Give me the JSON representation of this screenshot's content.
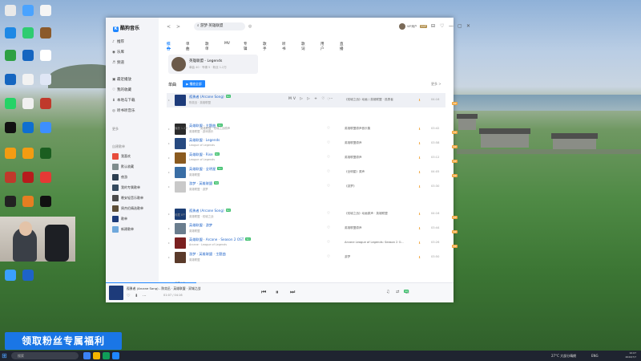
{
  "desktop": {
    "icons": [
      {
        "label": "",
        "color": "#e9e9e9"
      },
      {
        "label": "",
        "color": "#4aa3ff"
      },
      {
        "label": "",
        "color": "#f5f5f5"
      },
      {
        "label": "",
        "color": "#1e88e5"
      },
      {
        "label": "",
        "color": "#2ecc71"
      },
      {
        "label": "",
        "color": "#8b5a2b"
      },
      {
        "label": "",
        "color": "#2ea043"
      },
      {
        "label": "",
        "color": "#1565c0"
      },
      {
        "label": "",
        "color": "#ffffff"
      },
      {
        "label": "",
        "color": "#1565c0"
      },
      {
        "label": "",
        "color": "#f2f2f2"
      },
      {
        "label": "",
        "color": "#dfe6f5"
      },
      {
        "label": "",
        "color": "#25d366"
      },
      {
        "label": "",
        "color": "#f0f0f0"
      },
      {
        "label": "",
        "color": "#c0392b"
      },
      {
        "label": "",
        "color": "#111111"
      },
      {
        "label": "",
        "color": "#0f6fd1"
      },
      {
        "label": "",
        "color": "#3d8fff"
      },
      {
        "label": "",
        "color": "#f39c12"
      },
      {
        "label": "",
        "color": "#f39c12"
      },
      {
        "label": "",
        "color": "#1b5e20"
      },
      {
        "label": "",
        "color": "#c0392b"
      },
      {
        "label": "",
        "color": "#b71c1c"
      },
      {
        "label": "",
        "color": "#e53935"
      },
      {
        "label": "",
        "color": "#222222"
      },
      {
        "label": "",
        "color": "#e67e22"
      },
      {
        "label": "",
        "color": "#111111"
      },
      {
        "label": "",
        "color": "#3aa0ff"
      },
      {
        "label": "",
        "color": "#1e63c8"
      },
      {
        "label": "",
        "color": "#f57c00"
      }
    ]
  },
  "promo": {
    "text": "领取粉丝专属福利"
  },
  "taskbar": {
    "search_placeholder": "搜索",
    "weather": "27°C 大部分晴朗",
    "tray": "ENG",
    "time": "10:07",
    "date": "2024/7/7"
  },
  "app": {
    "name": "酷狗音乐",
    "logo_mark": "K",
    "nav": [
      {
        "icon": "♪",
        "label": "推荐"
      },
      {
        "icon": "◉",
        "label": "乐库"
      },
      {
        "icon": "♬",
        "label": "频道"
      },
      {
        "icon": "▣",
        "label": "最近播放"
      },
      {
        "icon": "♡",
        "label": "我的收藏"
      },
      {
        "icon": "⬇",
        "label": "本地与下载"
      },
      {
        "icon": "◎",
        "label": "听书听音乐"
      }
    ],
    "sections": {
      "favorites": "更多",
      "playlists": "自建歌单"
    },
    "playlists": [
      {
        "label": "我喜欢",
        "color": "#e74c3c"
      },
      {
        "label": "默认收藏",
        "color": "#7f8c8d"
      },
      {
        "label": "夜游",
        "color": "#2c3e50"
      },
      {
        "label": "我的专属歌单",
        "color": "#34495e"
      },
      {
        "label": "晚安轻音乐歌单",
        "color": "#4a4a4a"
      },
      {
        "label": "周杰伦精选歌单",
        "color": "#5d4e37"
      },
      {
        "label": "歌单",
        "color": "#1d3b7a"
      },
      {
        "label": "新建歌单",
        "color": "#6fa8dc"
      }
    ],
    "search_value": "游梦·英雄联盟",
    "nav_back": "<",
    "nav_forward": ">",
    "user": {
      "name": "VIP用户",
      "vip": "SVIP"
    },
    "window_controls": [
      "⊟",
      "♡",
      "—",
      "▢",
      "✕"
    ],
    "tabs": [
      "综合",
      "单曲",
      "歌单",
      "MV",
      "专辑",
      "歌手",
      "听书",
      "歌词",
      "用户",
      "直播"
    ],
    "artist": {
      "name": "英雄联盟 - Legends",
      "sub": "单曲 40 · 专辑 5 · 粉丝 1.2万"
    },
    "single_label": "单曲",
    "play_all": "▶ 播放全部",
    "more": "更多 >",
    "songs": [
      {
        "title": "孤勇者 (Arcane Song)",
        "meta": "陈奕迅 · 英雄联盟",
        "badges": [
          "VIP",
          "SQ"
        ],
        "album": "《双城之战》动画 / 英雄联盟 · 孤勇者",
        "duration": "04:16",
        "dl": "⬇",
        "cover": "#1d3b7a",
        "highlight": true,
        "actions": "MV ▷ ▷ + ♡ ⋯"
      },
      {
        "title": "英雄联盟 · 主题曲",
        "meta": "英雄联盟 · 游戏音乐",
        "badges": [
          "VIP",
          "SQ"
        ],
        "album": "英雄联盟原声音乐集",
        "duration": "03:42",
        "dl": "⬇",
        "cover": "#2b2b2b",
        "highlight": false,
        "actions": ""
      },
      {
        "title": "英雄联盟 · Legends",
        "meta": "League of Legends",
        "badges": [
          "VIP"
        ],
        "album": "英雄联盟原声",
        "duration": "03:58",
        "dl": "⬇",
        "cover": "#274a80",
        "highlight": false,
        "actions": ""
      },
      {
        "title": "英雄联盟 · Rise",
        "meta": "League of Legends",
        "badges": [
          "VIP",
          "SQ"
        ],
        "album": "英雄联盟原声",
        "duration": "03:12",
        "dl": "⬇",
        "cover": "#8a5a1f",
        "highlight": false,
        "actions": ""
      },
      {
        "title": "英雄联盟 · 全明星",
        "meta": "英雄联盟",
        "badges": [
          "VIP",
          "SQ"
        ],
        "album": "《全明星》原声",
        "duration": "04:05",
        "dl": "⬇",
        "cover": "#3a6ea5",
        "highlight": false,
        "actions": ""
      },
      {
        "title": "游梦 · 英雄联盟",
        "meta": "英雄联盟 · 游梦",
        "badges": [
          "SQ"
        ],
        "album": "《游梦》",
        "duration": "03:30",
        "dl": "⬇",
        "cover": "#c9c9c9",
        "highlight": false,
        "actions": ""
      },
      {
        "title": "孤勇者 (Arcane Song)",
        "meta": "英雄联盟 · 双城之战",
        "badges": [
          "VIP",
          "SQ"
        ],
        "album": "《双城之战》动画原声 · 英雄联盟",
        "duration": "04:16",
        "dl": "⬇",
        "cover": "#1b3d73",
        "highlight": false,
        "actions": ""
      },
      {
        "title": "英雄联盟 · 游梦",
        "meta": "英雄联盟",
        "badges": [
          "VIP"
        ],
        "album": "英雄联盟原声",
        "duration": "03:44",
        "dl": "⬇",
        "cover": "#6a7d8e",
        "highlight": false,
        "actions": ""
      },
      {
        "title": "英雄联盟 · Arcane · Season 2 OST",
        "meta": "Arcane · League of Legends",
        "badges": [
          "VIP",
          "SQ"
        ],
        "album": "Arcane League of Legends: Season 2 O...",
        "duration": "03:26",
        "dl": "⬇",
        "cover": "#7a2020",
        "highlight": false,
        "actions": ""
      },
      {
        "title": "游梦 · 英雄联盟 · 主题曲",
        "meta": "英雄联盟",
        "badges": [],
        "album": "游梦",
        "duration": "03:50",
        "dl": "⬇",
        "cover": "#5a3a2a",
        "highlight": false,
        "actions": ""
      }
    ],
    "row_notes": [
      {
        "label": "播放 1.2万",
        "note": "英雄联盟 · 双城之战原声"
      },
      {
        "label": "收藏 8千",
        "note": ""
      },
      {
        "label": "收藏 5千",
        "note": ""
      }
    ],
    "player": {
      "title": "孤勇者 (Arcane Song) - 陈奕迅 · 英雄联盟 · 双城之战",
      "icons": "♡ ⬇ ⋯",
      "time": "01:07 / 04:16",
      "progress": 0.26,
      "prev": "⏮",
      "pause": "⏸",
      "next": "⏭",
      "right_icons": "♫ ⇄ ◧",
      "quality": "SQ"
    }
  }
}
